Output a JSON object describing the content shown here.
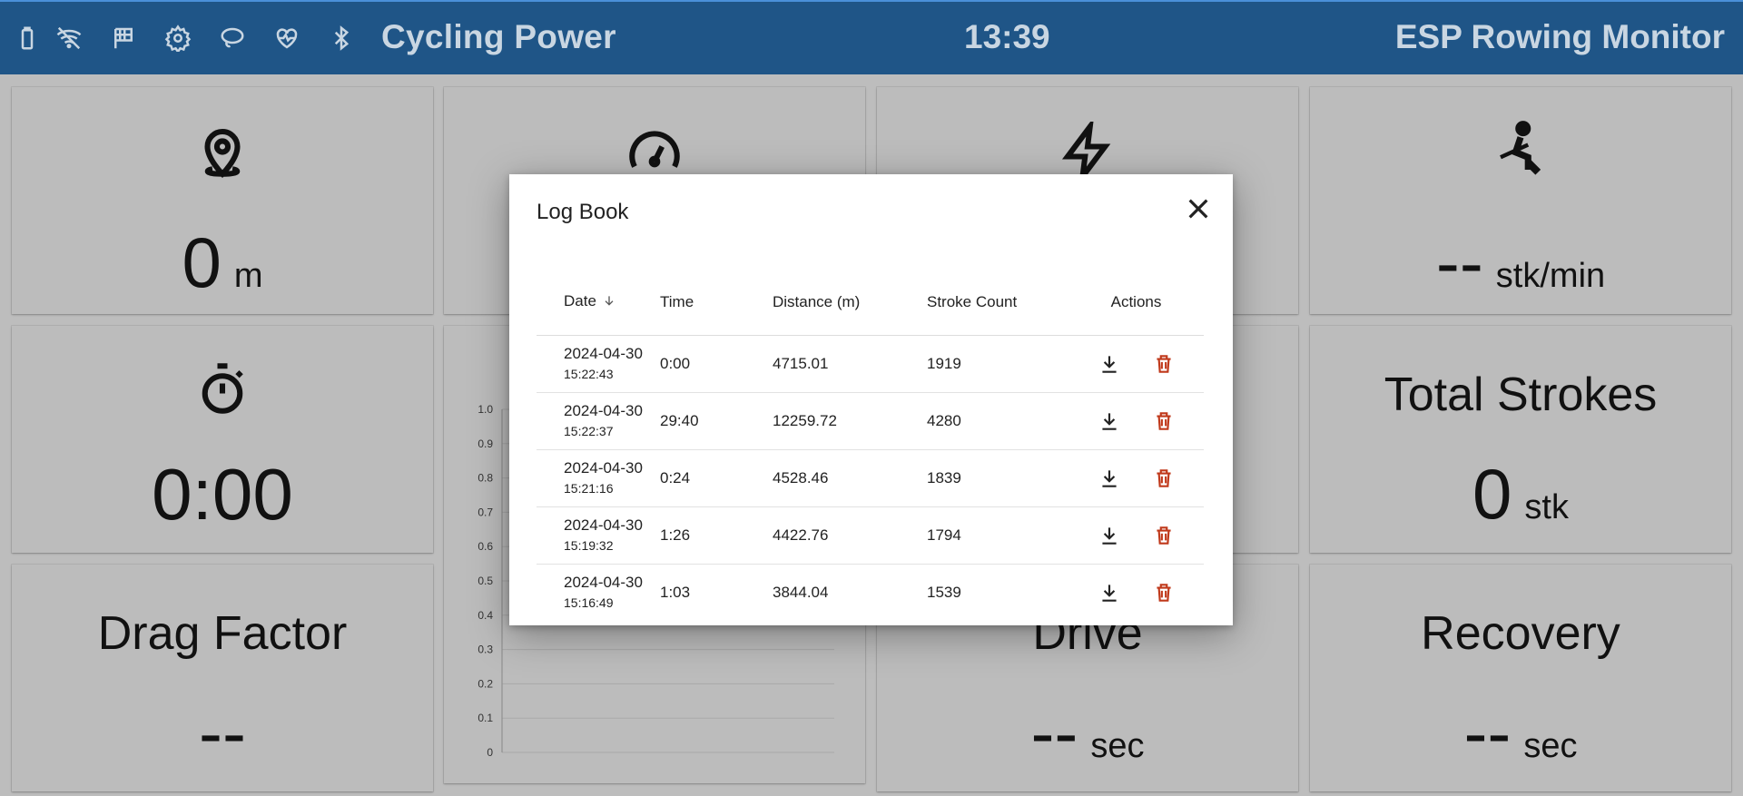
{
  "topbar": {
    "mode": "Cycling Power",
    "clock": "13:39",
    "app_title": "ESP Rowing Monitor",
    "icons": [
      "battery-icon",
      "wifi-off-icon",
      "checkered-flag-icon",
      "gear-icon",
      "lasso-icon",
      "heart-rate-icon",
      "bluetooth-icon"
    ],
    "color": "#1f5587"
  },
  "tiles": {
    "distance": {
      "icon": "location-pin-icon",
      "value": "0",
      "unit": "m"
    },
    "speed": {
      "icon": "speedometer-icon"
    },
    "power": {
      "icon": "lightning-icon"
    },
    "stroke_rate": {
      "icon": "rower-icon",
      "value": "--",
      "unit": "stk/min"
    },
    "time": {
      "icon": "stopwatch-icon",
      "value": "0:00"
    },
    "total_strokes": {
      "title": "Total Strokes",
      "value": "0",
      "unit": "stk"
    },
    "drag_factor": {
      "title": "Drag Factor",
      "value": "--"
    },
    "drive": {
      "title": "Drive",
      "value": "--",
      "unit": "sec"
    },
    "recovery": {
      "title": "Recovery",
      "value": "--",
      "unit": "sec"
    }
  },
  "chart_data": {
    "type": "line",
    "y_ticks": [
      "1.0",
      "0.9",
      "0.8",
      "0.7",
      "0.6",
      "0.5",
      "0.4",
      "0.3",
      "0.2",
      "0.1",
      "0"
    ],
    "ylim": [
      0,
      1
    ],
    "series": [],
    "grid": true
  },
  "dialog": {
    "title": "Log Book",
    "columns": [
      "Date",
      "Time",
      "Distance (m)",
      "Stroke Count",
      "Actions"
    ],
    "rows": [
      {
        "date": "2024-04-30",
        "clock": "15:22:43",
        "time": "0:00",
        "distance": "4715.01",
        "strokes": "1919"
      },
      {
        "date": "2024-04-30",
        "clock": "15:22:37",
        "time": "29:40",
        "distance": "12259.72",
        "strokes": "4280"
      },
      {
        "date": "2024-04-30",
        "clock": "15:21:16",
        "time": "0:24",
        "distance": "4528.46",
        "strokes": "1839"
      },
      {
        "date": "2024-04-30",
        "clock": "15:19:32",
        "time": "1:26",
        "distance": "4422.76",
        "strokes": "1794"
      },
      {
        "date": "2024-04-30",
        "clock": "15:16:49",
        "time": "1:03",
        "distance": "3844.04",
        "strokes": "1539"
      }
    ],
    "delete_color": "#c0391b"
  }
}
